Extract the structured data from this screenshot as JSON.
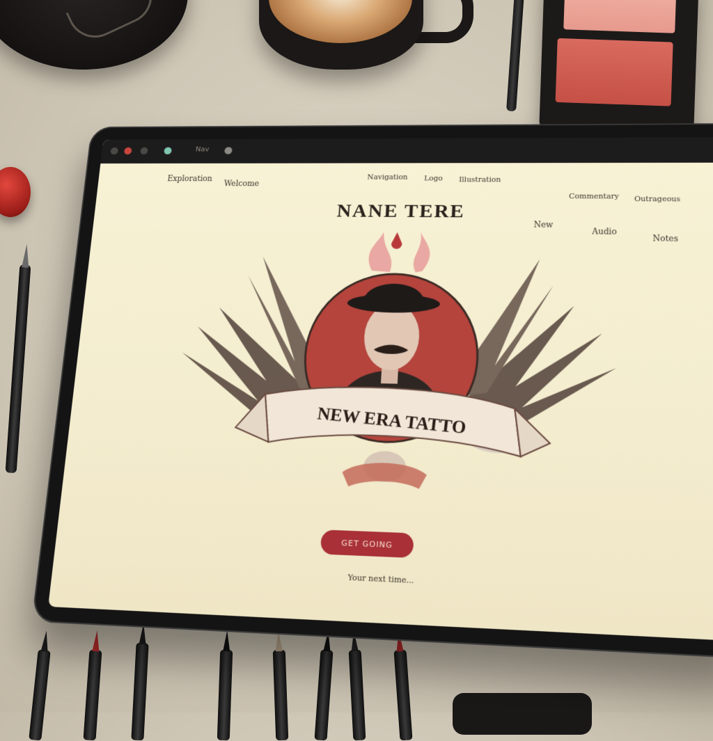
{
  "browser": {
    "tab_label": "Nav"
  },
  "nav": {
    "left": [
      "Exploration",
      "Welcome"
    ],
    "center": [
      "Navigation",
      "Logo",
      "Illustration"
    ],
    "right_top": [
      "Commentary",
      "Outrageous"
    ],
    "right": [
      "New",
      "Audio",
      "Notes"
    ]
  },
  "site": {
    "wordmark": "NANE TERE",
    "banner_text": "NEW ERA TATTO",
    "cta_label": "GET GOING",
    "footer_text": "Your next time..."
  },
  "colors": {
    "accent": "#a83036",
    "screen_bg": "#f6efd2",
    "ink": "#2a221c"
  }
}
